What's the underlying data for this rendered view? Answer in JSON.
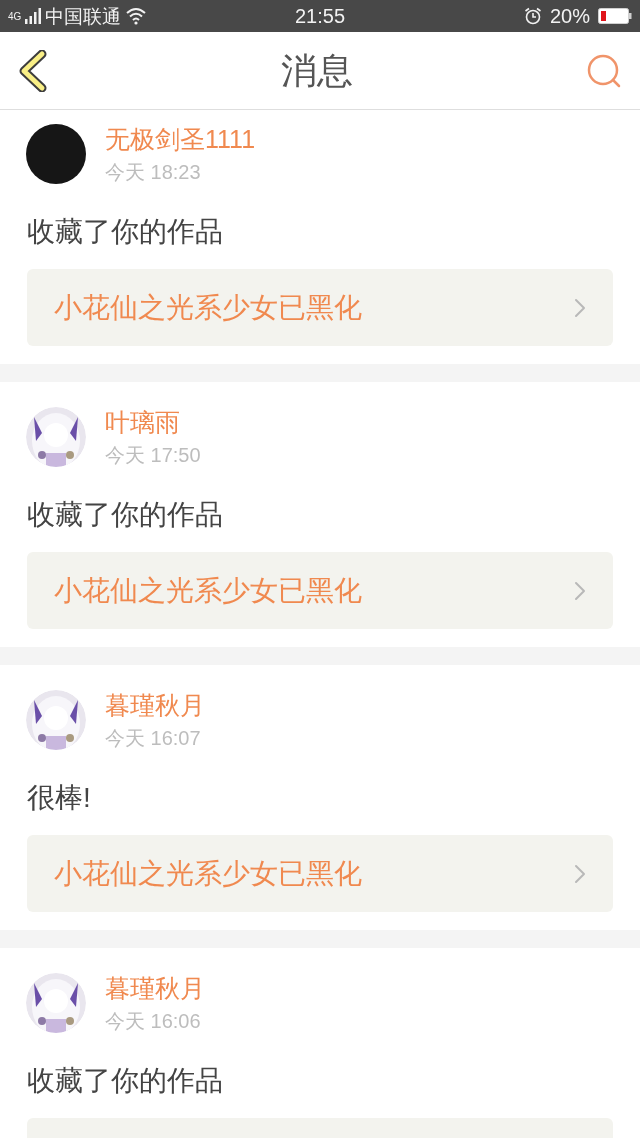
{
  "status_bar": {
    "network": "4G",
    "carrier": "中国联通",
    "time": "21:55",
    "battery": "20%"
  },
  "header": {
    "title": "消息"
  },
  "messages": [
    {
      "avatar": {
        "kind": "plain"
      },
      "name": "无极剑圣1111",
      "time": "今天 18:23",
      "text": "收藏了你的作品",
      "work": "小花仙之光系少女已黑化"
    },
    {
      "name": "叶璃雨",
      "time": "今天 17:50",
      "text": "收藏了你的作品",
      "work": "小花仙之光系少女已黑化"
    },
    {
      "name": "暮瑾秋月",
      "time": "今天 16:07",
      "text": "很棒!",
      "work": "小花仙之光系少女已黑化"
    },
    {
      "name": "暮瑾秋月",
      "time": "今天 16:06",
      "text": "收藏了你的作品"
    }
  ]
}
